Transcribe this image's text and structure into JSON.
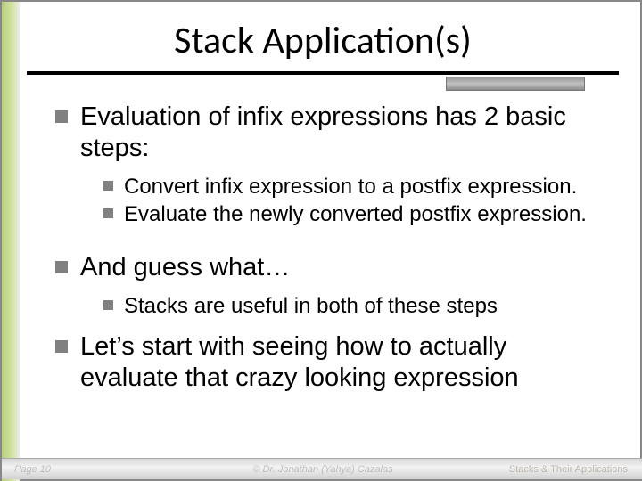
{
  "title": "Stack Application(s)",
  "bullets": {
    "b1": "Evaluation of infix expressions has 2 basic steps:",
    "b1_sub1": "Convert infix expression to a postfix expression.",
    "b1_sub2": "Evaluate the newly converted postfix expression.",
    "b2": "And guess what…",
    "b2_sub1": "Stacks are useful in both of these steps",
    "b3": "Let’s start with seeing how to actually evaluate that crazy looking expression"
  },
  "footer": {
    "left": "Page 10",
    "center": "© Dr. Jonathan (Yahya) Cazalas",
    "right": "Stacks & Their Applications"
  }
}
